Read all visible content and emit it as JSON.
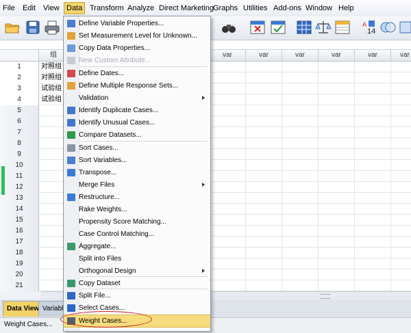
{
  "menubar": {
    "items": [
      "File",
      "Edit",
      "View",
      "Data",
      "Transform",
      "Analyze",
      "Direct Marketing",
      "Graphs",
      "Utilities",
      "Add-ons",
      "Window",
      "Help"
    ],
    "active": "Data"
  },
  "grid": {
    "columns": [
      "组",
      "var",
      "var",
      "var",
      "var",
      "var",
      "var"
    ],
    "rows": [
      "1",
      "2",
      "3",
      "4",
      "5",
      "6",
      "7",
      "8",
      "9",
      "10",
      "11",
      "12",
      "13",
      "14",
      "15",
      "16",
      "17",
      "18",
      "19",
      "20",
      "21"
    ],
    "cells": [
      "对照组",
      "对照组",
      "试验组",
      "试验组"
    ]
  },
  "data_menu": {
    "items": [
      {
        "label": "Define Variable Properties...",
        "icon": "define-variable-icon"
      },
      {
        "label": "Set Measurement Level for Unknown...",
        "icon": "measurement-level-icon"
      },
      {
        "label": "Copy Data Properties...",
        "icon": "copy-properties-icon"
      },
      {
        "label": "New Custom Attribute...",
        "icon": "custom-attribute-icon",
        "disabled": true
      },
      {
        "label": "Define Dates...",
        "icon": "calendar-icon"
      },
      {
        "label": "Define Multiple Response Sets...",
        "icon": "multiple-response-icon"
      },
      {
        "label": "Validation",
        "submenu": true
      },
      {
        "label": "Identify Duplicate Cases...",
        "icon": "duplicate-cases-icon"
      },
      {
        "label": "Identify Unusual Cases...",
        "icon": "unusual-cases-icon"
      },
      {
        "label": "Compare Datasets...",
        "icon": "compare-datasets-icon"
      },
      {
        "label": "Sort Cases...",
        "icon": "sort-cases-icon"
      },
      {
        "label": "Sort Variables...",
        "icon": "sort-variables-icon"
      },
      {
        "label": "Transpose...",
        "icon": "transpose-icon"
      },
      {
        "label": "Merge Files",
        "submenu": true
      },
      {
        "label": "Restructure...",
        "icon": "restructure-icon"
      },
      {
        "label": "Rake Weights..."
      },
      {
        "label": "Propensity Score Matching..."
      },
      {
        "label": "Case Control Matching..."
      },
      {
        "label": "Aggregate...",
        "icon": "aggregate-icon"
      },
      {
        "label": "Split into Files"
      },
      {
        "label": "Orthogonal Design",
        "submenu": true
      },
      {
        "label": "Copy Dataset",
        "icon": "copy-dataset-icon"
      },
      {
        "label": "Split File...",
        "icon": "split-file-icon"
      },
      {
        "label": "Select Cases...",
        "icon": "select-cases-icon"
      },
      {
        "label": "Weight Cases...",
        "icon": "weight-cases-icon",
        "highlighted": true
      }
    ]
  },
  "tabs": {
    "data_view": "Data View",
    "variable_view": "Variable"
  },
  "status": {
    "text": "Weight Cases..."
  }
}
